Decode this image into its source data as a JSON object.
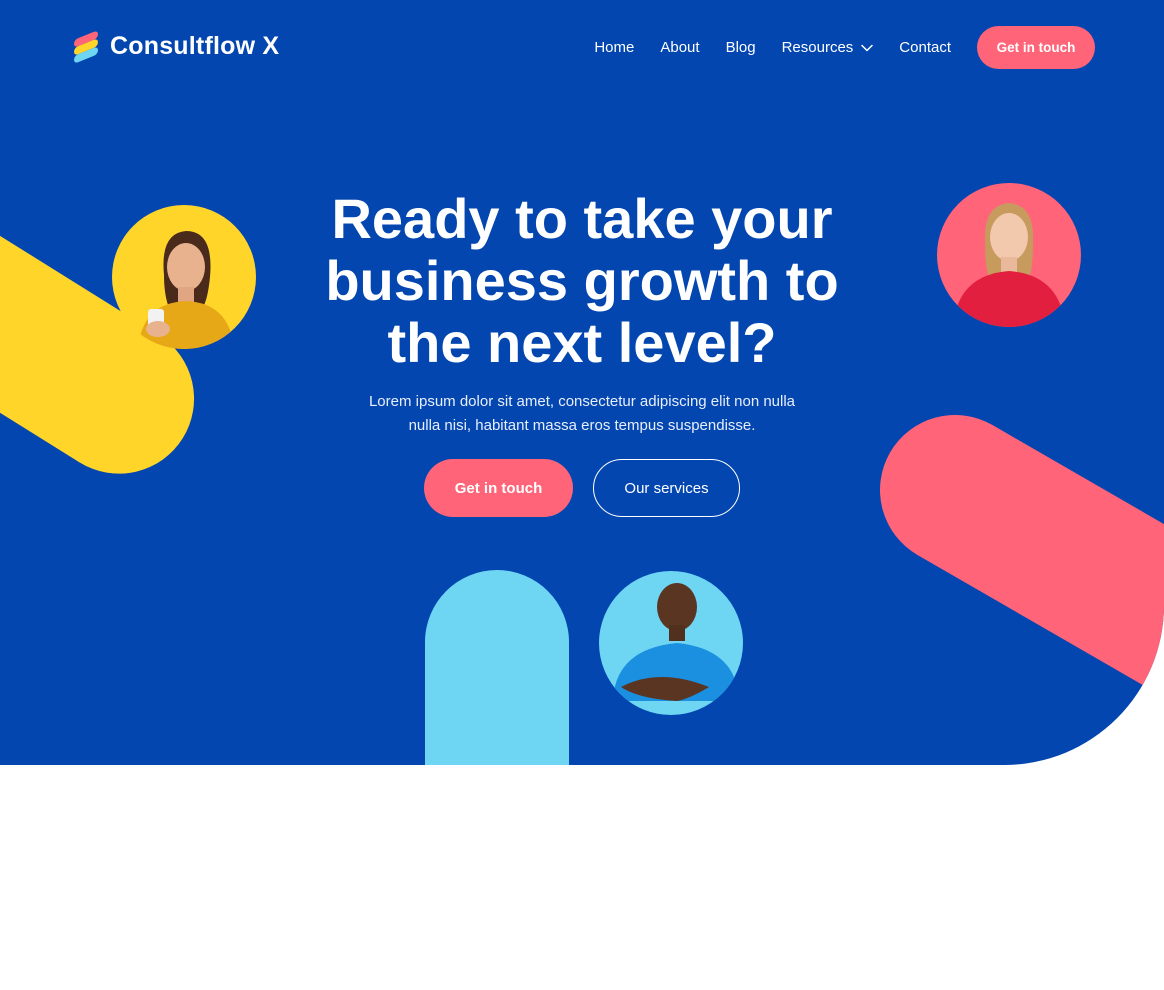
{
  "brand": {
    "name": "Consultflow X"
  },
  "nav": {
    "links": [
      "Home",
      "About",
      "Blog",
      "Resources",
      "Contact"
    ],
    "cta_label": "Get in touch"
  },
  "hero": {
    "title": "Ready to take your business growth to the next level?",
    "subtitle": "Lorem ipsum dolor sit amet, consectetur adipiscing elit non nulla nulla nisi, habitant massa eros tempus suspendisse.",
    "primary_cta": "Get in touch",
    "secondary_cta": "Our services"
  },
  "colors": {
    "background": "#0346B0",
    "accent_pink": "#FF6479",
    "accent_yellow": "#FFD52A",
    "accent_cyan": "#6ED5F3",
    "white": "#FFFFFF"
  },
  "icons": {
    "logo": "stacked-bars-logo-icon",
    "resources_dropdown": "chevron-down-icon"
  }
}
